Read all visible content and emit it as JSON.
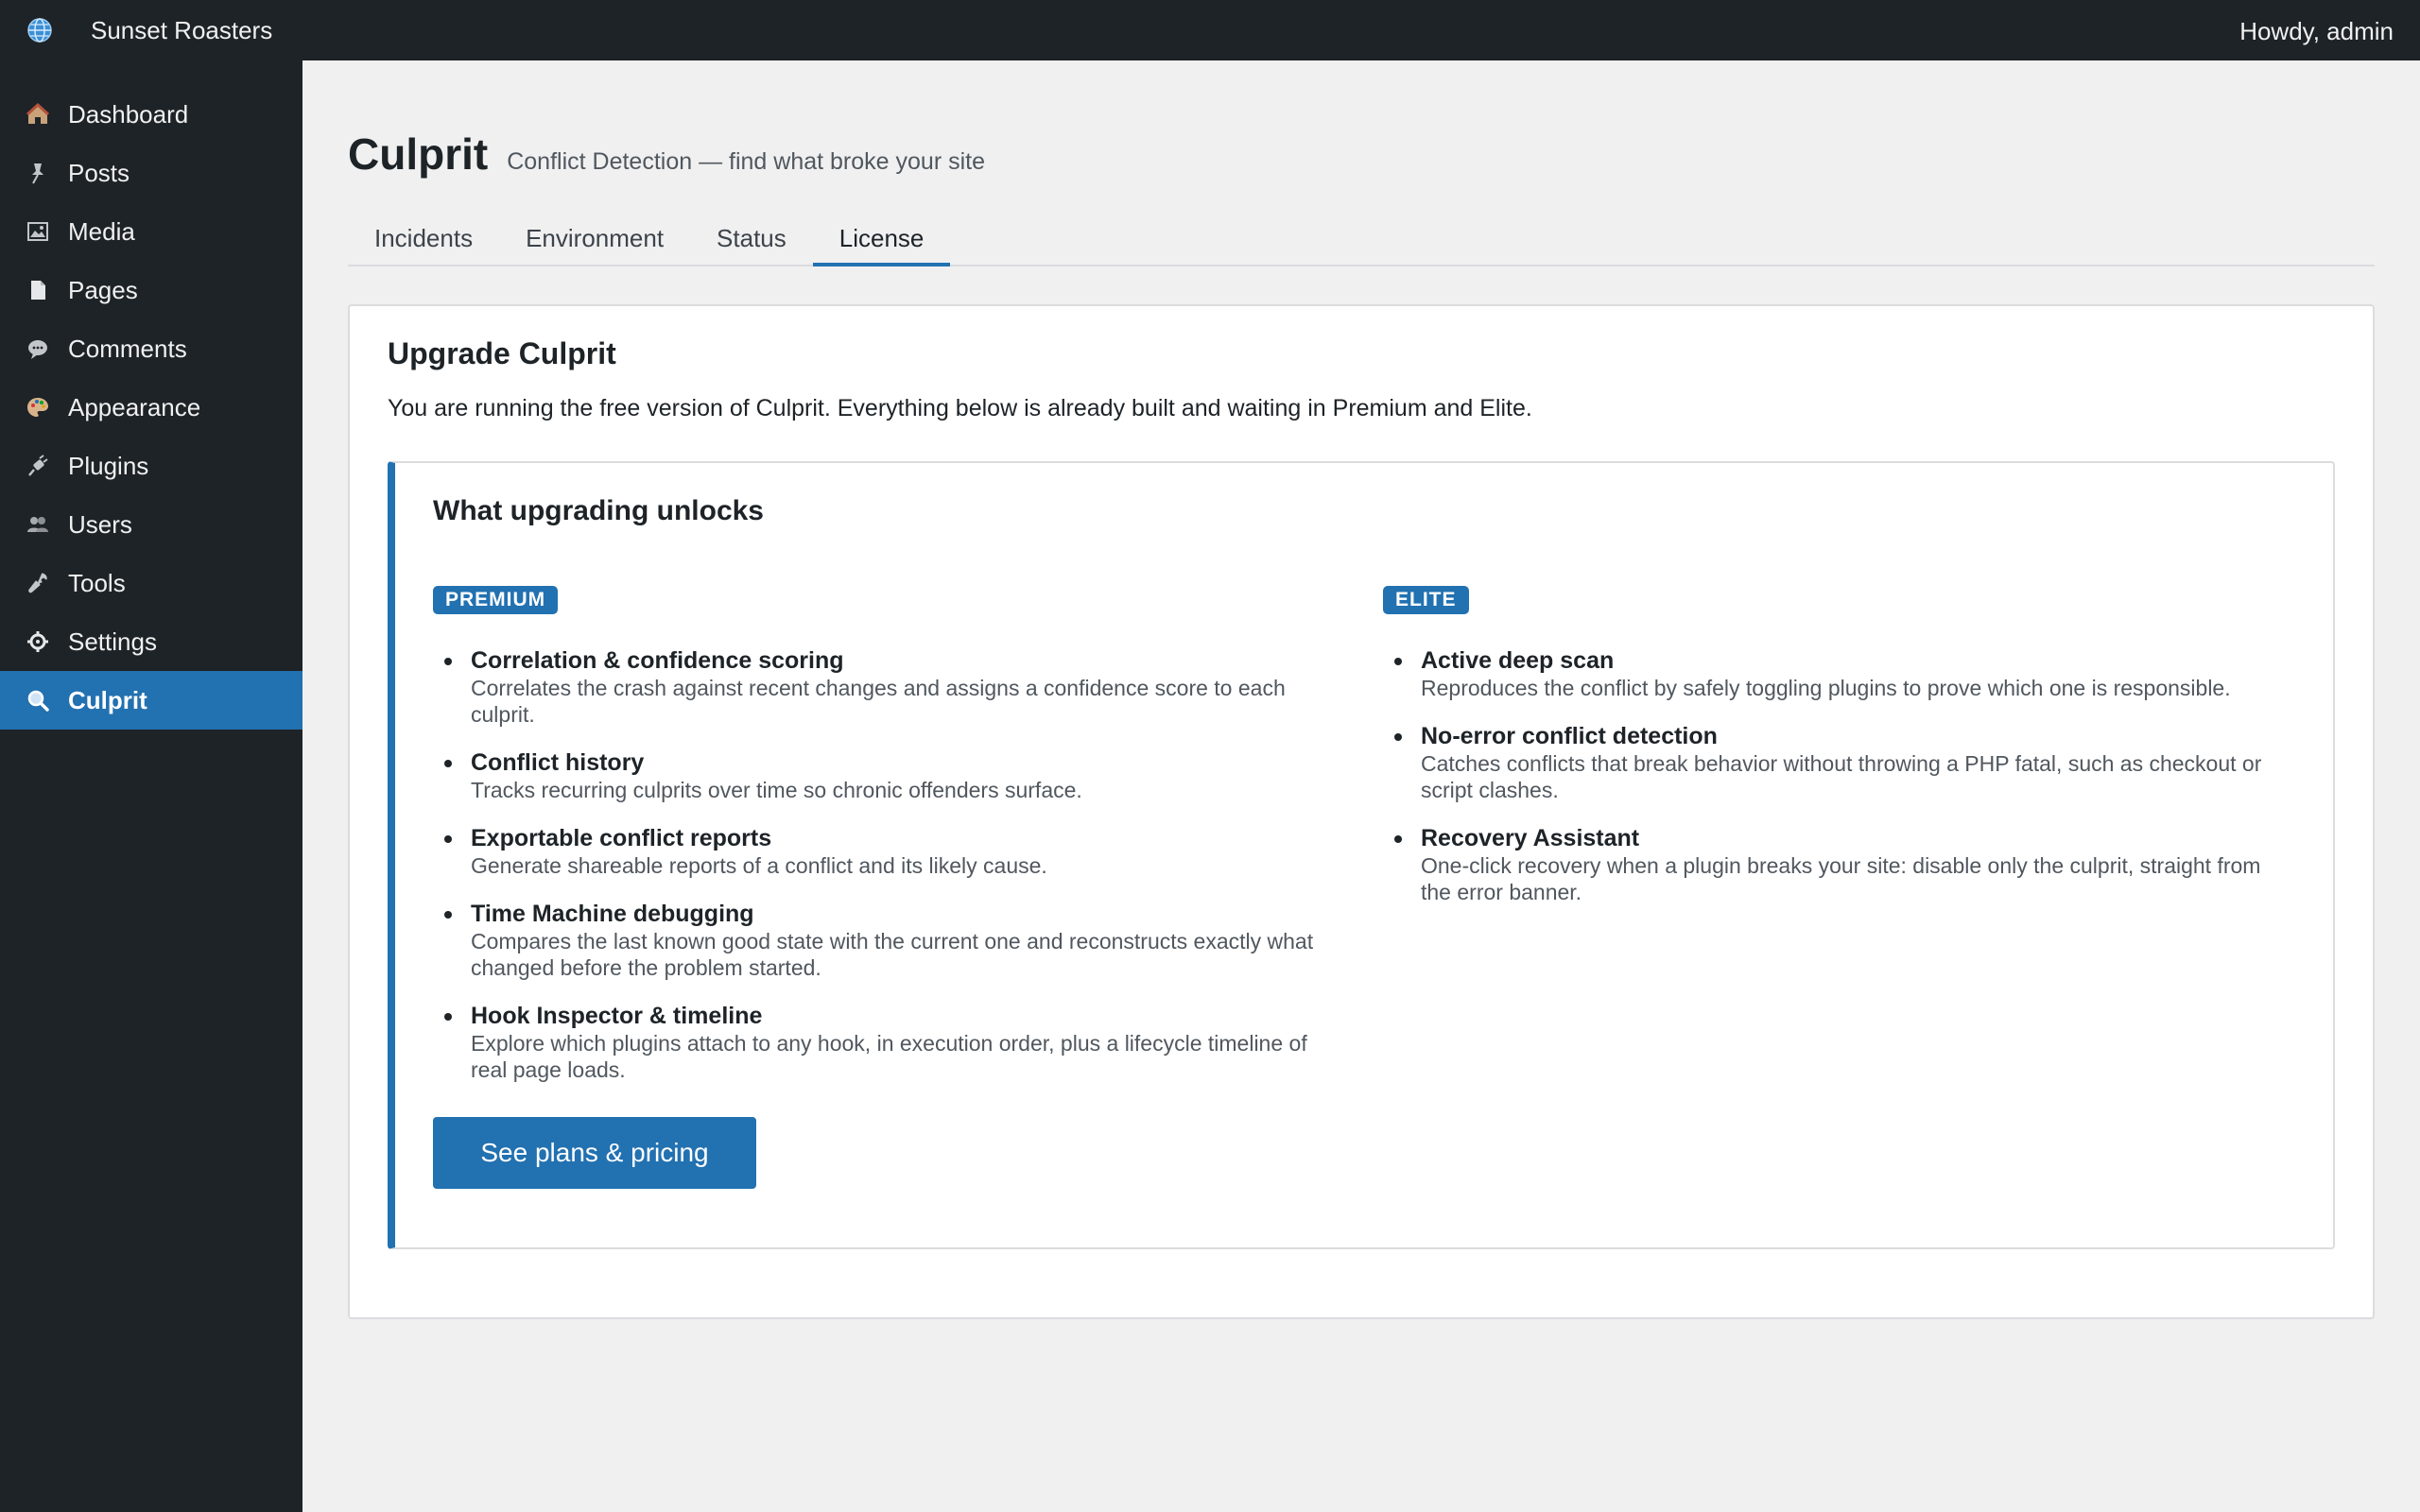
{
  "adminbar": {
    "site_name": "Sunset Roasters",
    "howdy": "Howdy, admin",
    "logo_icon": "globe-icon"
  },
  "sidebar": {
    "items": [
      {
        "label": "Dashboard",
        "icon": "house-icon"
      },
      {
        "label": "Posts",
        "icon": "pin-icon"
      },
      {
        "label": "Media",
        "icon": "picture-icon"
      },
      {
        "label": "Pages",
        "icon": "page-icon"
      },
      {
        "label": "Comments",
        "icon": "speech-bubble-icon"
      },
      {
        "label": "Appearance",
        "icon": "palette-icon"
      },
      {
        "label": "Plugins",
        "icon": "plug-icon"
      },
      {
        "label": "Users",
        "icon": "users-icon"
      },
      {
        "label": "Tools",
        "icon": "wrench-icon"
      },
      {
        "label": "Settings",
        "icon": "gear-icon"
      },
      {
        "label": "Culprit",
        "icon": "magnifier-icon",
        "active": true
      }
    ]
  },
  "page": {
    "title": "Culprit",
    "subtitle": "Conflict Detection — find what broke your site"
  },
  "tabs": [
    {
      "label": "Incidents"
    },
    {
      "label": "Environment"
    },
    {
      "label": "Status"
    },
    {
      "label": "License",
      "active": true
    }
  ],
  "card": {
    "title": "Upgrade Culprit",
    "description": "You are running the free version of Culprit. Everything below is already built and waiting in Premium and Elite."
  },
  "unlock": {
    "title": "What upgrading unlocks",
    "premium": {
      "badge": "PREMIUM",
      "features": [
        {
          "name": "Correlation & confidence scoring",
          "desc": "Correlates the crash against recent changes and assigns a confidence score to each culprit."
        },
        {
          "name": "Conflict history",
          "desc": "Tracks recurring culprits over time so chronic offenders surface."
        },
        {
          "name": "Exportable conflict reports",
          "desc": "Generate shareable reports of a conflict and its likely cause."
        },
        {
          "name": "Time Machine debugging",
          "desc": "Compares the last known good state with the current one and reconstructs exactly what changed before the problem started."
        },
        {
          "name": "Hook Inspector & timeline",
          "desc": "Explore which plugins attach to any hook, in execution order, plus a lifecycle timeline of real page loads."
        }
      ]
    },
    "elite": {
      "badge": "ELITE",
      "features": [
        {
          "name": "Active deep scan",
          "desc": "Reproduces the conflict by safely toggling plugins to prove which one is responsible."
        },
        {
          "name": "No-error conflict detection",
          "desc": "Catches conflicts that break behavior without throwing a PHP fatal, such as checkout or script clashes."
        },
        {
          "name": "Recovery Assistant",
          "desc": "One-click recovery when a plugin breaks your site: disable only the culprit, straight from the error banner."
        }
      ]
    },
    "cta_label": "See plans & pricing"
  },
  "colors": {
    "accent": "#2271b1",
    "adminbar": "#1d2327",
    "background": "#f0f0f1"
  }
}
